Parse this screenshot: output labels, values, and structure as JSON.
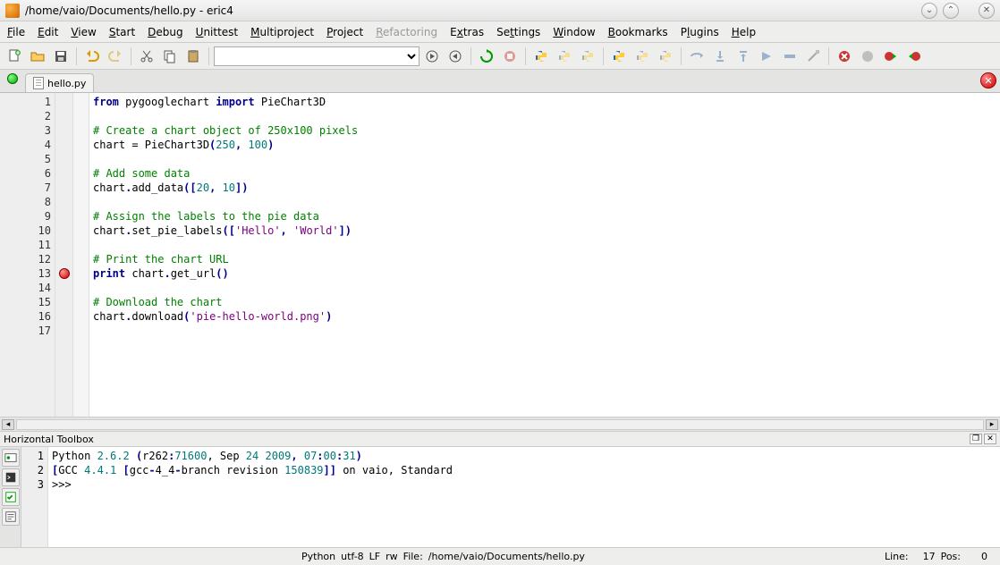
{
  "window": {
    "title": "/home/vaio/Documents/hello.py - eric4"
  },
  "menu": {
    "file": "File",
    "edit": "Edit",
    "view": "View",
    "start": "Start",
    "debug": "Debug",
    "unittest": "Unittest",
    "multiproject": "Multiproject",
    "project": "Project",
    "refactoring": "Refactoring",
    "extras": "Extras",
    "settings": "Settings",
    "window": "Window",
    "bookmarks": "Bookmarks",
    "plugins": "Plugins",
    "help": "Help"
  },
  "tab": {
    "filename": "hello.py"
  },
  "code": {
    "lines": [
      {
        "n": 1,
        "segs": [
          {
            "t": "from",
            "c": "kw"
          },
          {
            "t": " pygooglechart "
          },
          {
            "t": "import",
            "c": "kw"
          },
          {
            "t": " PieChart3D"
          }
        ]
      },
      {
        "n": 2,
        "segs": []
      },
      {
        "n": 3,
        "segs": [
          {
            "t": "# Create a chart object of 250x100 pixels",
            "c": "cm"
          }
        ]
      },
      {
        "n": 4,
        "segs": [
          {
            "t": "chart = PieChart3D"
          },
          {
            "t": "(",
            "c": "kw"
          },
          {
            "t": "250",
            "c": "nu"
          },
          {
            "t": ", ",
            "c": "kw"
          },
          {
            "t": "100",
            "c": "nu"
          },
          {
            "t": ")",
            "c": "kw"
          }
        ]
      },
      {
        "n": 5,
        "segs": []
      },
      {
        "n": 6,
        "segs": [
          {
            "t": "# Add some data",
            "c": "cm"
          }
        ]
      },
      {
        "n": 7,
        "segs": [
          {
            "t": "chart"
          },
          {
            "t": ".",
            "c": "kw"
          },
          {
            "t": "add_data"
          },
          {
            "t": "([",
            "c": "kw"
          },
          {
            "t": "20",
            "c": "nu"
          },
          {
            "t": ", ",
            "c": "kw"
          },
          {
            "t": "10",
            "c": "nu"
          },
          {
            "t": "])",
            "c": "kw"
          }
        ]
      },
      {
        "n": 8,
        "segs": []
      },
      {
        "n": 9,
        "segs": [
          {
            "t": "# Assign the labels to the pie data",
            "c": "cm"
          }
        ]
      },
      {
        "n": 10,
        "segs": [
          {
            "t": "chart"
          },
          {
            "t": ".",
            "c": "kw"
          },
          {
            "t": "set_pie_labels"
          },
          {
            "t": "([",
            "c": "kw"
          },
          {
            "t": "'Hello'",
            "c": "st"
          },
          {
            "t": ", ",
            "c": "kw"
          },
          {
            "t": "'World'",
            "c": "st"
          },
          {
            "t": "])",
            "c": "kw"
          }
        ]
      },
      {
        "n": 11,
        "segs": []
      },
      {
        "n": 12,
        "segs": [
          {
            "t": "# Print the chart URL",
            "c": "cm"
          }
        ]
      },
      {
        "n": 13,
        "bp": true,
        "segs": [
          {
            "t": "print",
            "c": "kw"
          },
          {
            "t": " chart"
          },
          {
            "t": ".",
            "c": "kw"
          },
          {
            "t": "get_url"
          },
          {
            "t": "()",
            "c": "kw"
          }
        ]
      },
      {
        "n": 14,
        "segs": []
      },
      {
        "n": 15,
        "segs": [
          {
            "t": "# Download the chart",
            "c": "cm"
          }
        ]
      },
      {
        "n": 16,
        "segs": [
          {
            "t": "chart"
          },
          {
            "t": ".",
            "c": "kw"
          },
          {
            "t": "download"
          },
          {
            "t": "(",
            "c": "kw"
          },
          {
            "t": "'pie-hello-world.png'",
            "c": "st"
          },
          {
            "t": ")",
            "c": "kw"
          }
        ]
      },
      {
        "n": 17,
        "segs": []
      }
    ]
  },
  "toolbox": {
    "title": "Horizontal Toolbox",
    "lines": [
      {
        "n": 1,
        "segs": [
          {
            "t": "Python "
          },
          {
            "t": "2.6.2",
            "c": "nu"
          },
          {
            "t": " ",
            "c": ""
          },
          {
            "t": "(",
            "c": "kw"
          },
          {
            "t": "r262"
          },
          {
            "t": ":",
            "c": "kw"
          },
          {
            "t": "71600",
            "c": "nu"
          },
          {
            "t": ", Sep ",
            "c": ""
          },
          {
            "t": "24",
            "c": "nu"
          },
          {
            "t": " "
          },
          {
            "t": "2009",
            "c": "nu"
          },
          {
            "t": ", ",
            "c": "kw"
          },
          {
            "t": "07",
            "c": "nu"
          },
          {
            "t": ":",
            "c": "kw"
          },
          {
            "t": "00",
            "c": "nu"
          },
          {
            "t": ":",
            "c": "kw"
          },
          {
            "t": "31",
            "c": "nu"
          },
          {
            "t": ")",
            "c": "kw"
          }
        ]
      },
      {
        "n": 2,
        "segs": [
          {
            "t": "[",
            "c": "kw"
          },
          {
            "t": "GCC "
          },
          {
            "t": "4.4.1",
            "c": "nu"
          },
          {
            "t": " "
          },
          {
            "t": "[",
            "c": "kw"
          },
          {
            "t": "gcc"
          },
          {
            "t": "-",
            "c": "kw"
          },
          {
            "t": "4"
          },
          {
            "t": "_4",
            "c": ""
          },
          {
            "t": "-",
            "c": "kw"
          },
          {
            "t": "branch revision "
          },
          {
            "t": "150839",
            "c": "nu"
          },
          {
            "t": "]]",
            "c": "kw"
          },
          {
            "t": " on vaio, Standard"
          }
        ]
      },
      {
        "n": 3,
        "segs": [
          {
            "t": ">>> "
          }
        ]
      }
    ]
  },
  "status": {
    "lang": "Python",
    "enc": "utf-8",
    "eol": "LF",
    "mode": "rw",
    "file_label": "File:",
    "file_path": "/home/vaio/Documents/hello.py",
    "line_label": "Line:",
    "line": "17",
    "pos_label": "Pos:",
    "pos": "0"
  }
}
